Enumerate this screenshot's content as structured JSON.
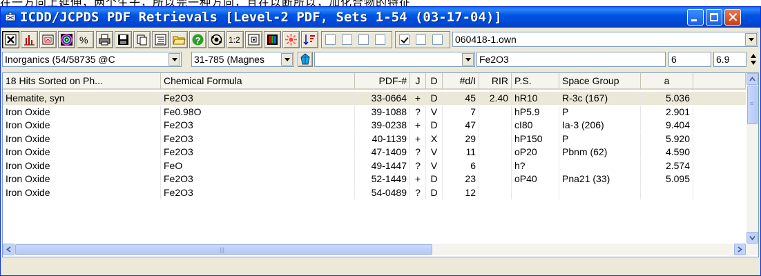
{
  "window": {
    "title": "ICDD/JCPDS PDF Retrievals [Level-2 PDF, Sets 1-54 (03-17-04)]",
    "behind_text": "在一方向上延伸，两个生子，所以完一种方向，且在以断所以，加化合物的特征"
  },
  "toolbar": {
    "file_select": "060418-1.own",
    "checkboxes_a": [
      false,
      false,
      false,
      false
    ],
    "checkboxes_b": [
      true,
      false,
      false
    ]
  },
  "filters": {
    "database": "Inorganics (54/58735 @C",
    "reference": "31-785 (Magnes",
    "element_filter": "",
    "formula": "Fe2O3",
    "min_value": "6",
    "max_value": "6.9"
  },
  "grid": {
    "columns": [
      "18 Hits Sorted on Ph...",
      "Chemical Formula",
      "PDF-#",
      "J",
      "D",
      "#d/I",
      "RIR",
      "P.S.",
      "Space Group",
      "a"
    ],
    "rows": [
      [
        "Hematite, syn",
        "Fe2O3",
        "33-0664",
        "+",
        "D",
        "45",
        "2.40",
        "hR10",
        "R-3c (167)",
        "5.036"
      ],
      [
        "Iron Oxide",
        "Fe0.98O",
        "39-1088",
        "?",
        "V",
        "7",
        "",
        "hP5.9",
        "P",
        "2.901"
      ],
      [
        "Iron Oxide",
        "Fe2O3",
        "39-0238",
        "+",
        "D",
        "47",
        "",
        "cI80",
        "Ia-3 (206)",
        "9.404"
      ],
      [
        "Iron Oxide",
        "Fe2O3",
        "40-1139",
        "+",
        "X",
        "29",
        "",
        "hP150",
        "P",
        "5.920"
      ],
      [
        "Iron Oxide",
        "Fe2O3",
        "47-1409",
        "?",
        "V",
        "11",
        "",
        "oP20",
        "Pbnm (62)",
        "4.590"
      ],
      [
        "Iron Oxide",
        "FeO",
        "49-1447",
        "?",
        "V",
        "6",
        "",
        "h?",
        "",
        "2.574"
      ],
      [
        "Iron Oxide",
        "Fe2O3",
        "52-1449",
        "+",
        "D",
        "23",
        "",
        "oP40",
        "Pna21 (33)",
        "5.095"
      ],
      [
        "Iron Oxide",
        "Fe2O3",
        "54-0489",
        "?",
        "D",
        "12",
        "",
        "",
        "",
        ""
      ]
    ],
    "selected_row": 0
  }
}
